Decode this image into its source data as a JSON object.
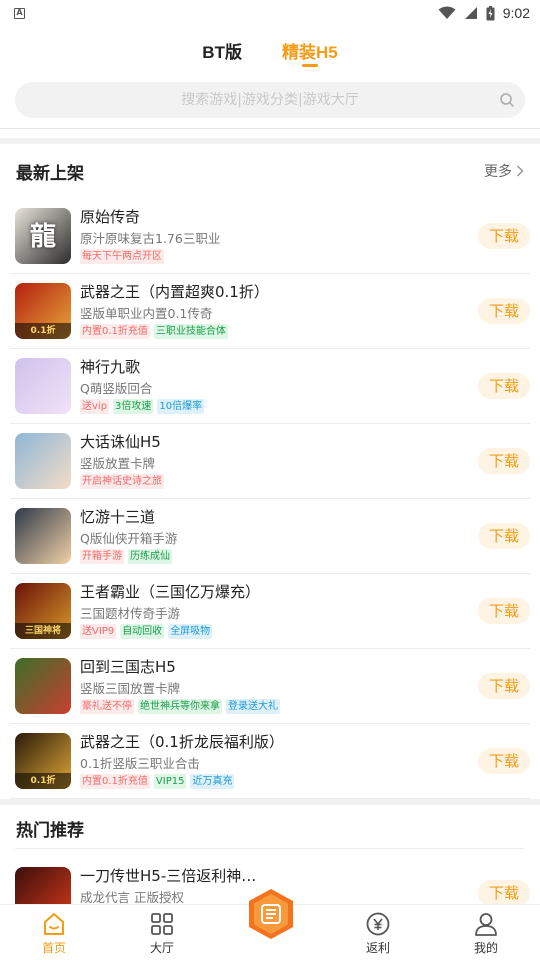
{
  "status_bar": {
    "time": "9:02",
    "app_letter": "A"
  },
  "top_tabs": [
    {
      "label": "BT版",
      "active": false
    },
    {
      "label": "精装H5",
      "active": true
    }
  ],
  "search": {
    "placeholder": "搜索游戏|游戏分类|游戏大厅"
  },
  "section_new": {
    "title": "最新上架",
    "more": "更多"
  },
  "games": [
    {
      "title": "原始传奇",
      "subtitle": "原汁原味复古1.76三职业",
      "tags": [
        {
          "text": "每天下午两点开区",
          "color": "red"
        }
      ],
      "download": "下载",
      "thumb_glyph": "龍",
      "thumb_colors": [
        "#e9e4dc",
        "#2b2b2b"
      ]
    },
    {
      "title": "武器之王（内置超爽0.1折）",
      "subtitle": "竖版单职业内置0.1传奇",
      "tags": [
        {
          "text": "内置0.1折充值",
          "color": "red"
        },
        {
          "text": "三职业技能合体",
          "color": "green"
        }
      ],
      "download": "下载",
      "thumb_glyph": "",
      "thumb_caption": "0.1折",
      "thumb_colors": [
        "#b3200f",
        "#e7a73b"
      ]
    },
    {
      "title": "神行九歌",
      "subtitle": "Q萌竖版回合",
      "tags": [
        {
          "text": "送vip",
          "color": "red"
        },
        {
          "text": "3倍攻速",
          "color": "green"
        },
        {
          "text": "10倍爆率",
          "color": "blue"
        }
      ],
      "download": "下载",
      "thumb_glyph": "",
      "thumb_colors": [
        "#cfc2ec",
        "#f1e2f6"
      ]
    },
    {
      "title": "大话诛仙H5",
      "subtitle": "竖版放置卡牌",
      "tags": [
        {
          "text": "开启神话史诗之旅",
          "color": "red"
        }
      ],
      "download": "下载",
      "thumb_glyph": "",
      "thumb_colors": [
        "#8fb7d8",
        "#f3dcc6"
      ]
    },
    {
      "title": "忆游十三道",
      "subtitle": "Q版仙侠开箱手游",
      "tags": [
        {
          "text": "开箱手游",
          "color": "red"
        },
        {
          "text": "历练成仙",
          "color": "green"
        }
      ],
      "download": "下载",
      "thumb_glyph": "",
      "thumb_colors": [
        "#2f3a4a",
        "#f2d1a5"
      ]
    },
    {
      "title": "王者霸业（三国亿万爆充）",
      "subtitle": "三国题材传奇手游",
      "tags": [
        {
          "text": "送VIP9",
          "color": "red"
        },
        {
          "text": "自动回收",
          "color": "green"
        },
        {
          "text": "全屏吸物",
          "color": "blue"
        }
      ],
      "download": "下载",
      "thumb_glyph": "",
      "thumb_caption": "三国神将",
      "thumb_colors": [
        "#6a1208",
        "#d89a2b"
      ]
    },
    {
      "title": "回到三国志H5",
      "subtitle": "竖版三国放置卡牌",
      "tags": [
        {
          "text": "豪礼送不停",
          "color": "red"
        },
        {
          "text": "绝世神兵等你来拿",
          "color": "green"
        },
        {
          "text": "登录送大礼",
          "color": "blue"
        }
      ],
      "download": "下载",
      "thumb_glyph": "",
      "thumb_colors": [
        "#3c6f2a",
        "#c7402f"
      ]
    },
    {
      "title": "武器之王（0.1折龙辰福利版）",
      "subtitle": "0.1折竖版三职业合击",
      "tags": [
        {
          "text": "内置0.1折充值",
          "color": "red"
        },
        {
          "text": "VIP15",
          "color": "green"
        },
        {
          "text": "近万真充",
          "color": "blue"
        }
      ],
      "download": "下载",
      "thumb_glyph": "",
      "thumb_caption": "0.1折",
      "thumb_colors": [
        "#2a1a08",
        "#e2a93a"
      ]
    }
  ],
  "section_hot": {
    "title": "热门推荐"
  },
  "hot_game": {
    "title": "一刀传世H5-三倍返利神…",
    "subtitle": "成龙代言 正版授权",
    "download": "下载",
    "thumb_colors": [
      "#3a0e0a",
      "#d63a1d"
    ]
  },
  "bottom_nav": [
    {
      "label": "首页",
      "icon": "home-icon",
      "active": true
    },
    {
      "label": "大厅",
      "icon": "grid-icon",
      "active": false
    },
    {
      "label": "",
      "icon": "center-hex-icon",
      "active": false
    },
    {
      "label": "返利",
      "icon": "yen-icon",
      "active": false
    },
    {
      "label": "我的",
      "icon": "user-icon",
      "active": false
    }
  ],
  "colors": {
    "accent": "#f59b15",
    "tag_red": "#f36a6a",
    "tag_green": "#1a9e4a",
    "tag_blue": "#1e9ad6"
  }
}
